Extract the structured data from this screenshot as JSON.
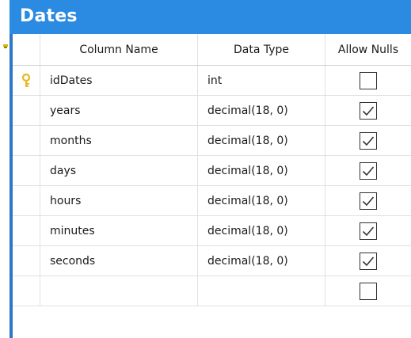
{
  "table": {
    "title": "Dates",
    "columns": {
      "name_header": "Column Name",
      "type_header": "Data Type",
      "nulls_header": "Allow Nulls"
    },
    "rows": [
      {
        "name": "idDates",
        "type": "int",
        "allow_nulls": false,
        "primary_key": true
      },
      {
        "name": "years",
        "type": "decimal(18, 0)",
        "allow_nulls": true,
        "primary_key": false
      },
      {
        "name": "months",
        "type": "decimal(18, 0)",
        "allow_nulls": true,
        "primary_key": false
      },
      {
        "name": "days",
        "type": "decimal(18, 0)",
        "allow_nulls": true,
        "primary_key": false
      },
      {
        "name": "hours",
        "type": "decimal(18, 0)",
        "allow_nulls": true,
        "primary_key": false
      },
      {
        "name": "minutes",
        "type": "decimal(18, 0)",
        "allow_nulls": true,
        "primary_key": false
      },
      {
        "name": "seconds",
        "type": "decimal(18, 0)",
        "allow_nulls": true,
        "primary_key": false
      },
      {
        "name": "",
        "type": "",
        "allow_nulls": false,
        "primary_key": false
      }
    ],
    "colors": {
      "title_bar": "#2b8ae1",
      "border": "#2b78c8",
      "key_icon": "#e8b820"
    },
    "icons": {
      "primary_key": "key-icon",
      "checked": "checkmark-icon"
    }
  }
}
